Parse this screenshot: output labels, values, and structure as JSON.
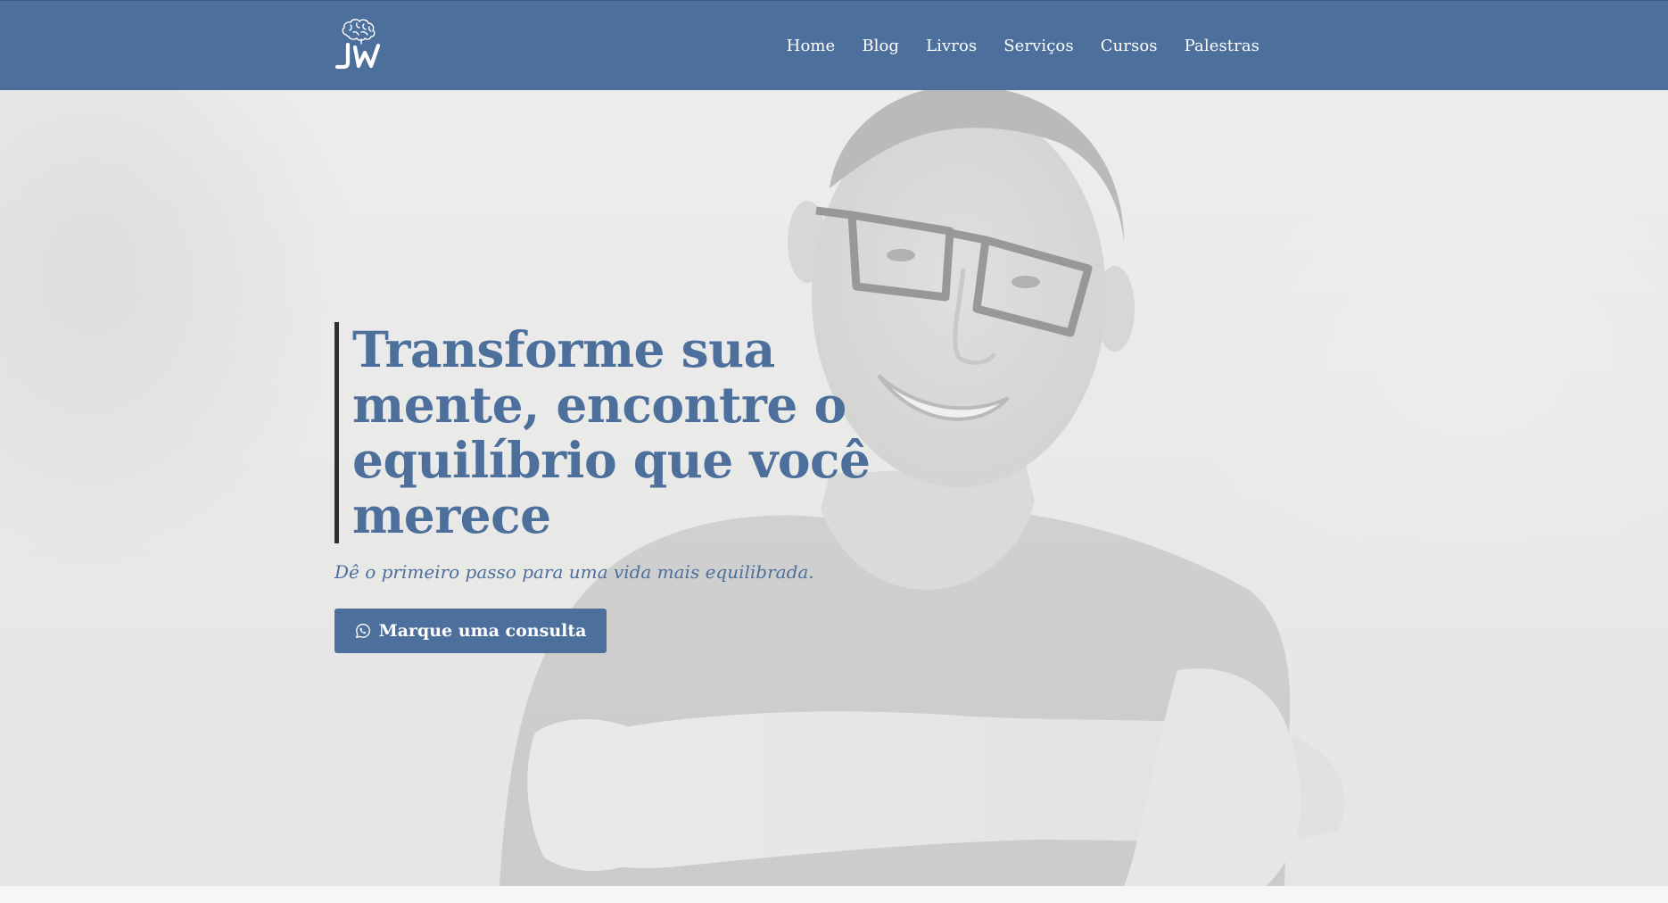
{
  "nav": {
    "logo_alt": "JW",
    "links": [
      {
        "label": "Home"
      },
      {
        "label": "Blog"
      },
      {
        "label": "Livros"
      },
      {
        "label": "Serviços"
      },
      {
        "label": "Cursos"
      },
      {
        "label": "Palestras"
      }
    ]
  },
  "hero": {
    "headline": "Transforme sua mente, encontre o equilíbrio que você merece",
    "subheadline": "Dê o primeiro passo para uma vida mais equilibrada.",
    "cta_label": "Marque uma consulta",
    "cta_icon": "whatsapp-icon"
  },
  "colors": {
    "brand": "#4c6f9c",
    "accent_bar": "#2b2f35",
    "background": "#ececeb"
  }
}
